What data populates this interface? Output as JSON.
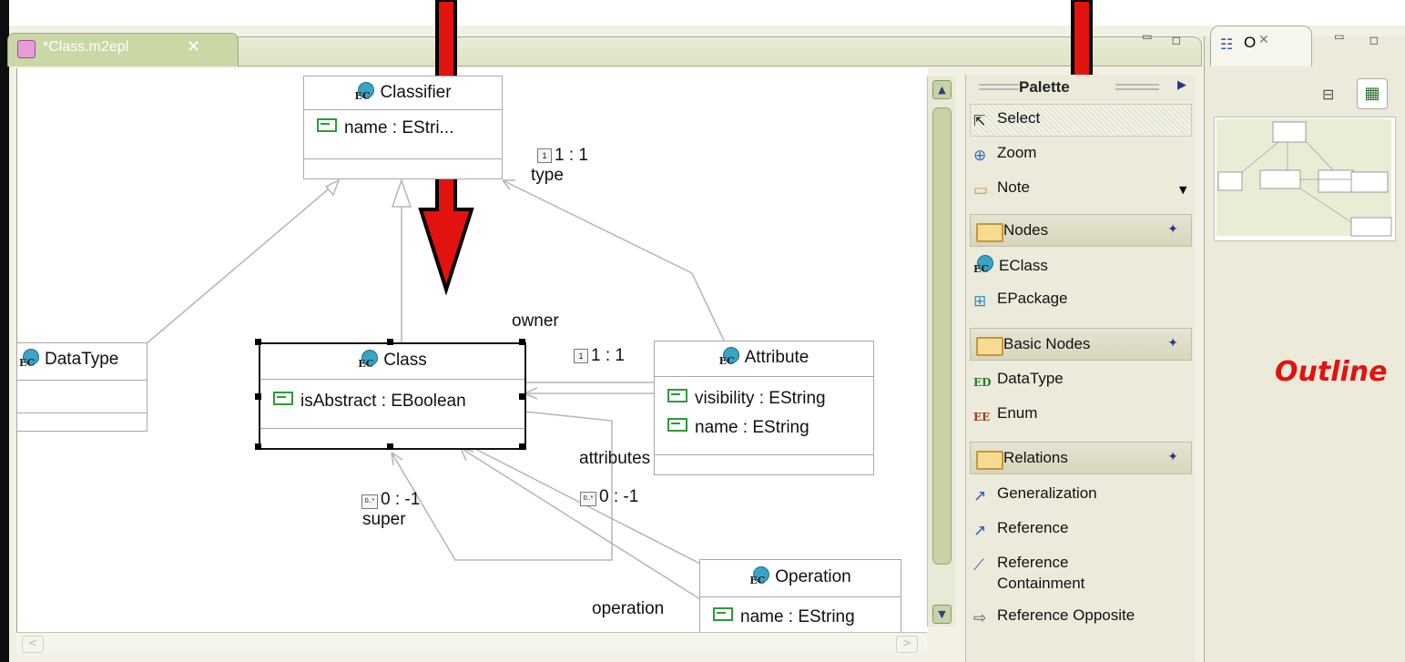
{
  "editor": {
    "tab_label": "*Class.m2epl",
    "close_glyph": "✕",
    "minimize_glyph": "▭",
    "maximize_glyph": "◻"
  },
  "diagram": {
    "classes": {
      "classifier": {
        "name": "Classifier",
        "attrs": [
          "name : EStri..."
        ]
      },
      "datatype": {
        "name": "DataType",
        "attrs": []
      },
      "class": {
        "name": "Class",
        "attrs": [
          "isAbstract : EBoolean"
        ]
      },
      "attribute": {
        "name": "Attribute",
        "attrs": [
          "visibility : EString",
          "name : EString"
        ]
      },
      "operation": {
        "name": "Operation",
        "attrs": [
          "name : EString"
        ]
      }
    },
    "labels": {
      "type": "type",
      "owner": "owner",
      "attributes": "attributes",
      "super": "super",
      "operation": "operation"
    },
    "multiplicities": {
      "type": "1 : 1",
      "owner": "1 : 1",
      "super": "0 : -1",
      "attributes": "0 : -1"
    },
    "multicon_one": "1",
    "multicon_many": "0..*"
  },
  "palette": {
    "title": "Palette",
    "tools": {
      "select": "Select",
      "zoom": "Zoom",
      "note": "Note"
    },
    "drawers": {
      "nodes": {
        "label": "Nodes",
        "items": [
          "EClass",
          "EPackage"
        ]
      },
      "basic_nodes": {
        "label": "Basic Nodes",
        "items": [
          "DataType",
          "Enum"
        ]
      },
      "relations": {
        "label": "Relations",
        "items": [
          "Generalization",
          "Reference",
          "Reference Containment",
          "Reference Opposite"
        ]
      }
    },
    "reference_containment_line1": "Reference",
    "reference_containment_line2": "Containment"
  },
  "outline": {
    "tab_label": "O",
    "caption": "Outline"
  },
  "colors": {
    "annotation_red": "#e2120f",
    "tab_green": "#c9d8a5",
    "scroll_green": "#c8d2a5"
  }
}
